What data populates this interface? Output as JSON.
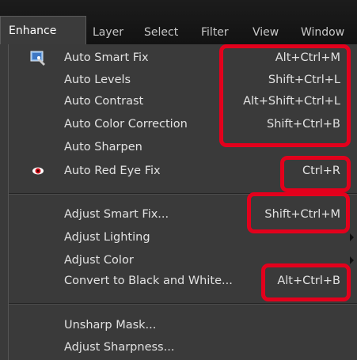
{
  "menubar": {
    "items": [
      {
        "label": "Enhance"
      },
      {
        "label": "Layer"
      },
      {
        "label": "Select"
      },
      {
        "label": "Filter"
      },
      {
        "label": "View"
      },
      {
        "label": "Window"
      }
    ]
  },
  "menu": {
    "items": [
      {
        "label": "Auto Smart Fix",
        "shortcut": "Alt+Ctrl+M",
        "icon": "auto-smart-fix-icon"
      },
      {
        "label": "Auto Levels",
        "shortcut": "Shift+Ctrl+L"
      },
      {
        "label": "Auto Contrast",
        "shortcut": "Alt+Shift+Ctrl+L"
      },
      {
        "label": "Auto Color Correction",
        "shortcut": "Shift+Ctrl+B"
      },
      {
        "label": "Auto Sharpen",
        "shortcut": ""
      },
      {
        "label": "Auto Red Eye Fix",
        "shortcut": "Ctrl+R",
        "icon": "red-eye-icon"
      },
      {
        "label": "Adjust Smart Fix...",
        "shortcut": "Shift+Ctrl+M"
      },
      {
        "label": "Adjust Lighting",
        "shortcut": "",
        "submenu": true
      },
      {
        "label": "Adjust Color",
        "shortcut": "",
        "submenu": true
      },
      {
        "label": "Convert to Black and White...",
        "shortcut": "Alt+Ctrl+B"
      },
      {
        "label": "Unsharp Mask...",
        "shortcut": ""
      },
      {
        "label": "Adjust Sharpness...",
        "shortcut": ""
      }
    ]
  },
  "colors": {
    "highlight": "#e3001c",
    "menu_background": "#3a3a3a",
    "menubar_background": "#151515",
    "text": "#e2e2e2"
  }
}
